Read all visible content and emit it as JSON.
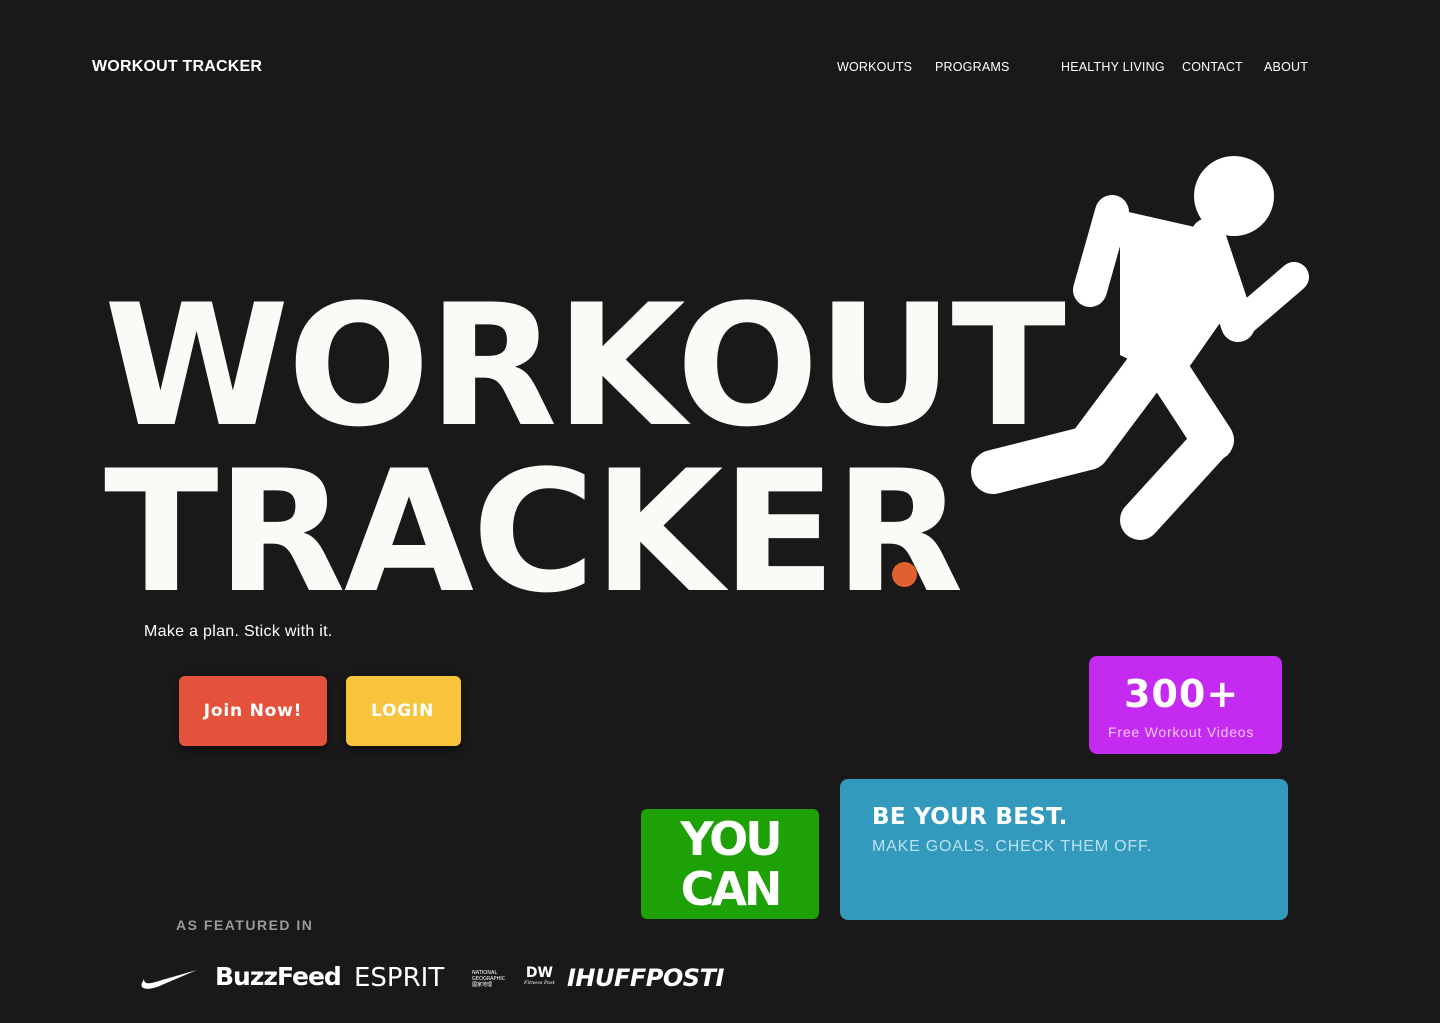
{
  "header": {
    "brand": "WORKOUT TRACKER",
    "nav": [
      "WORKOUTS",
      "PROGRAMS",
      "HEALTHY LIVING",
      "CONTACT",
      "ABOUT"
    ]
  },
  "hero": {
    "line1": "WORKOUT",
    "line2": "TRACKER",
    "dot_color": "#e0612f",
    "tagline": "Make a plan. Stick with it.",
    "illustration": "running-man-icon"
  },
  "buttons": {
    "join": "Join Now!",
    "login": "LOGIN",
    "join_color": "#e5523c",
    "login_color": "#f7c43b"
  },
  "stats_card": {
    "number": "300+",
    "label": "Free Workout Videos",
    "color": "#c52af0"
  },
  "you_can_card": {
    "line1": "YOU",
    "line2": "CAN",
    "color": "#1ea107"
  },
  "best_card": {
    "title": "BE YOUR BEST.",
    "subtitle": "MAKE GOALS. CHECK THEM OFF.",
    "color": "#3399bd"
  },
  "featured": {
    "label": "AS FEATURED IN",
    "logos": {
      "nike": "nike-swoosh-logo",
      "buzzfeed": "BuzzFeed",
      "esprit": "ESPRIT",
      "natgeo": [
        "NATIONAL",
        "GEOGRAPHIC",
        "國家地理"
      ],
      "dw": [
        "DW",
        "Fitness Post"
      ],
      "huffpost": "IHUFFPOSTI"
    }
  }
}
